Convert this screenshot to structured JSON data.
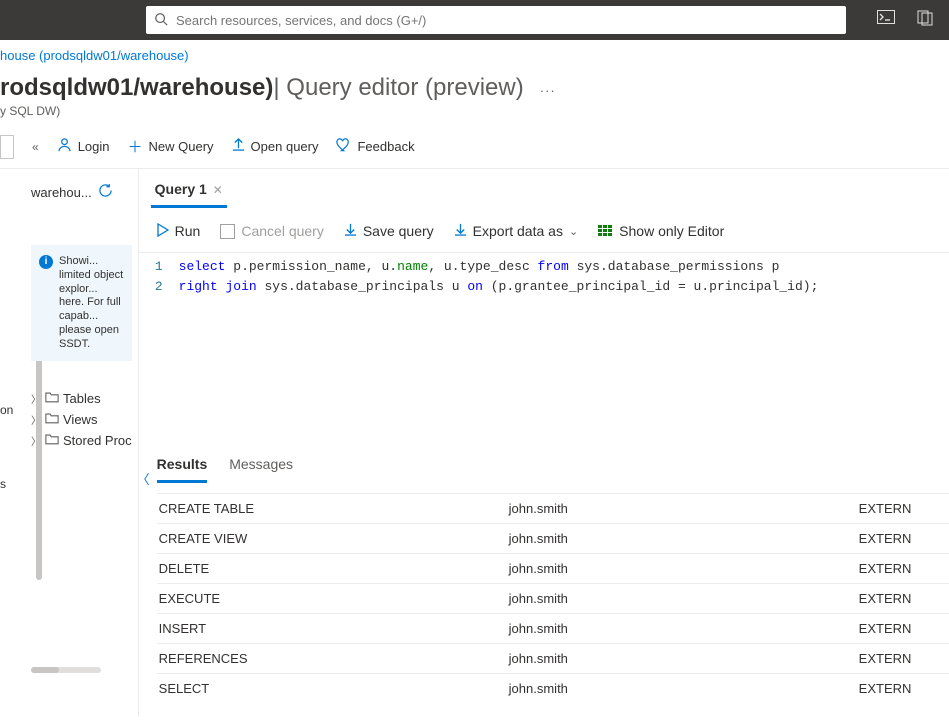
{
  "search": {
    "placeholder": "Search resources, services, and docs (G+/)"
  },
  "breadcrumb": {
    "text": "house (prodsqldw01/warehouse)"
  },
  "title": {
    "resource": "rodsqldw01/warehouse)",
    "section": " | Query editor (preview)",
    "subtitle": "y SQL DW)"
  },
  "cmdbar": {
    "login": "Login",
    "newquery": "New Query",
    "openquery": "Open query",
    "feedback": "Feedback"
  },
  "left_fragments": {
    "a": "on",
    "b": "s"
  },
  "explorer": {
    "dbname": "warehou...",
    "info_heading": "Showi...",
    "info_lines": "limited object explor... here. For full capab... please open SSDT.",
    "nodes": {
      "tables": "Tables",
      "views": "Views",
      "sprocs": "Stored Proc"
    }
  },
  "tabs": {
    "q1": "Query 1"
  },
  "toolbar": {
    "run": "Run",
    "cancel": "Cancel query",
    "save": "Save query",
    "export": "Export data as",
    "showeditor": "Show only Editor"
  },
  "code": {
    "ln1": "1",
    "ln2": "2",
    "l1_select": "select",
    "l1_a": " p.permission_name, u.",
    "l1_name": "name",
    "l1_b": ", u.type_desc ",
    "l1_from": "from",
    "l1_c": " sys.database_permissions p",
    "l2_rj": "right join",
    "l2_a": " sys.database_principals u ",
    "l2_on": "on",
    "l2_b": " (p.grantee_principal_id = u.principal_id);"
  },
  "results": {
    "tab_results": "Results",
    "tab_messages": "Messages",
    "rows": [
      {
        "perm": "CREATE TABLE",
        "user": "john.smith",
        "type": "EXTERN"
      },
      {
        "perm": "CREATE VIEW",
        "user": "john.smith",
        "type": "EXTERN"
      },
      {
        "perm": "DELETE",
        "user": "john.smith",
        "type": "EXTERN"
      },
      {
        "perm": "EXECUTE",
        "user": "john.smith",
        "type": "EXTERN"
      },
      {
        "perm": "INSERT",
        "user": "john.smith",
        "type": "EXTERN"
      },
      {
        "perm": "REFERENCES",
        "user": "john.smith",
        "type": "EXTERN"
      },
      {
        "perm": "SELECT",
        "user": "john.smith",
        "type": "EXTERN"
      }
    ]
  }
}
